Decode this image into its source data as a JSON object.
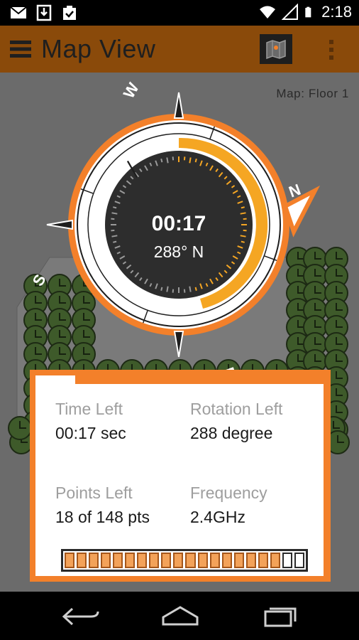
{
  "status_bar": {
    "time": "2:18",
    "icons": [
      "gmail-icon",
      "download-icon",
      "clipboard-check-icon",
      "wifi-icon",
      "cell-signal-icon",
      "battery-icon"
    ]
  },
  "app_bar": {
    "title": "Map View",
    "icons": [
      "menu-icon",
      "map-icon",
      "overflow-menu-icon"
    ],
    "color": "#8a4a0a"
  },
  "map": {
    "label": "Map: Floor 1"
  },
  "compass": {
    "timer": "00:17",
    "heading": "288° N",
    "cardinals": {
      "north": "N",
      "east": "E",
      "south": "S",
      "west": "W"
    },
    "accent_color": "#f3802a",
    "progress_color": "#f5a623"
  },
  "info_card": {
    "time_left_label": "Time Left",
    "time_left_value": "00:17 sec",
    "rotation_left_label": "Rotation Left",
    "rotation_left_value": "288 degree",
    "points_left_label": "Points Left",
    "points_left_value": "18 of 148 pts",
    "frequency_label": "Frequency",
    "frequency_value": "2.4GHz",
    "progress_segments_total": 20,
    "progress_segments_filled": 18
  },
  "nav_bar": {
    "icons": [
      "back-icon",
      "home-icon",
      "recents-icon"
    ]
  }
}
